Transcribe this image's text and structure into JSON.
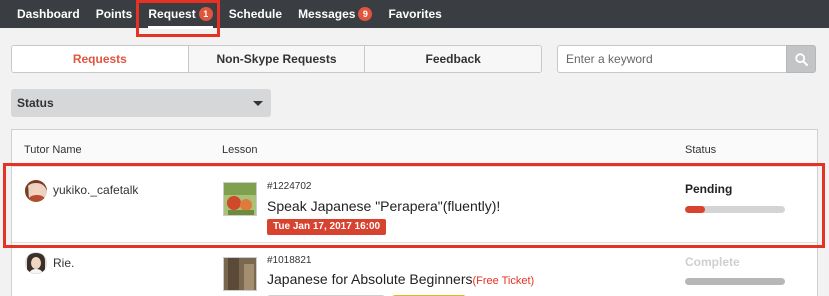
{
  "nav": {
    "items": [
      {
        "label": "Dashboard"
      },
      {
        "label": "Points"
      },
      {
        "label": "Request",
        "badge": "1"
      },
      {
        "label": "Schedule"
      },
      {
        "label": "Messages",
        "badge": "9"
      },
      {
        "label": "Favorites"
      }
    ]
  },
  "tabs": [
    {
      "label": "Requests"
    },
    {
      "label": "Non-Skype Requests"
    },
    {
      "label": "Feedback"
    }
  ],
  "search": {
    "placeholder": "Enter a keyword"
  },
  "filter": {
    "label": "Status"
  },
  "table": {
    "headers": {
      "tutor": "Tutor Name",
      "lesson": "Lesson",
      "status": "Status"
    },
    "rows": [
      {
        "tutor": "yukiko._cafetalk",
        "lesson_id": "#1224702",
        "title": "Speak Japanese \"Perapera\"(fluently)!",
        "date": "Tue Jan 17, 2017 16:00",
        "status": "Pending",
        "progress_fraction": 0.2
      },
      {
        "tutor": "Rie.",
        "lesson_id": "#1018821",
        "title": "Japanese for Absolute Beginners",
        "ticket": "(Free Ticket)",
        "status": "Complete",
        "progress_fraction": 1.0
      }
    ]
  },
  "colors": {
    "accent": "#e0553e",
    "highlight": "#e53224",
    "nav_bg": "#3a3d42"
  }
}
